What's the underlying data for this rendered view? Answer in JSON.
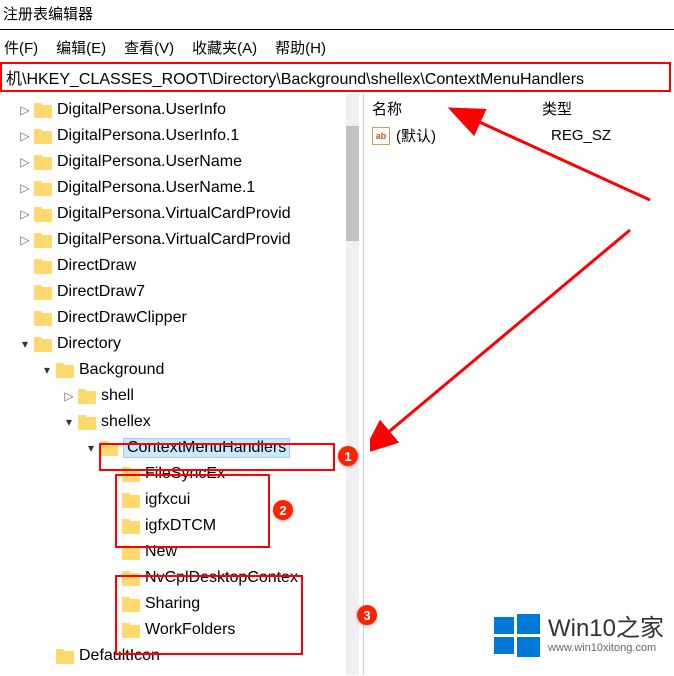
{
  "title": "注册表编辑器",
  "menu": {
    "file": "件(F)",
    "edit": "编辑(E)",
    "view": "查看(V)",
    "favorites": "收藏夹(A)",
    "help": "帮助(H)"
  },
  "address": "机\\HKEY_CLASSES_ROOT\\Directory\\Background\\shellex\\ContextMenuHandlers",
  "tree": {
    "n0": "DigitalPersona.UserInfo",
    "n1": "DigitalPersona.UserInfo.1",
    "n2": "DigitalPersona.UserName",
    "n3": "DigitalPersona.UserName.1",
    "n4": "DigitalPersona.VirtualCardProvid",
    "n5": "DigitalPersona.VirtualCardProvid",
    "n6": "DirectDraw",
    "n7": "DirectDraw7",
    "n8": "DirectDrawClipper",
    "n9": "Directory",
    "n10": "Background",
    "n11": "shell",
    "n12": "shellex",
    "n13": "ContextMenuHandlers",
    "n14": " FileSyncEx",
    "n15": "igfxcui",
    "n16": "igfxDTCM",
    "n17": "New",
    "n18": "NvCplDesktopContex",
    "n19": "Sharing",
    "n20": "WorkFolders",
    "n21": "DefaultIcon"
  },
  "list": {
    "col_name": "名称",
    "col_type": "类型",
    "default_name": "(默认)",
    "default_type": "REG_SZ",
    "string_icon_text": "ab"
  },
  "badges": {
    "b1": "1",
    "b2": "2",
    "b3": "3"
  },
  "watermark": {
    "brand": "Win10",
    "suffix": "之家",
    "url": "www.win10xitong.com"
  }
}
